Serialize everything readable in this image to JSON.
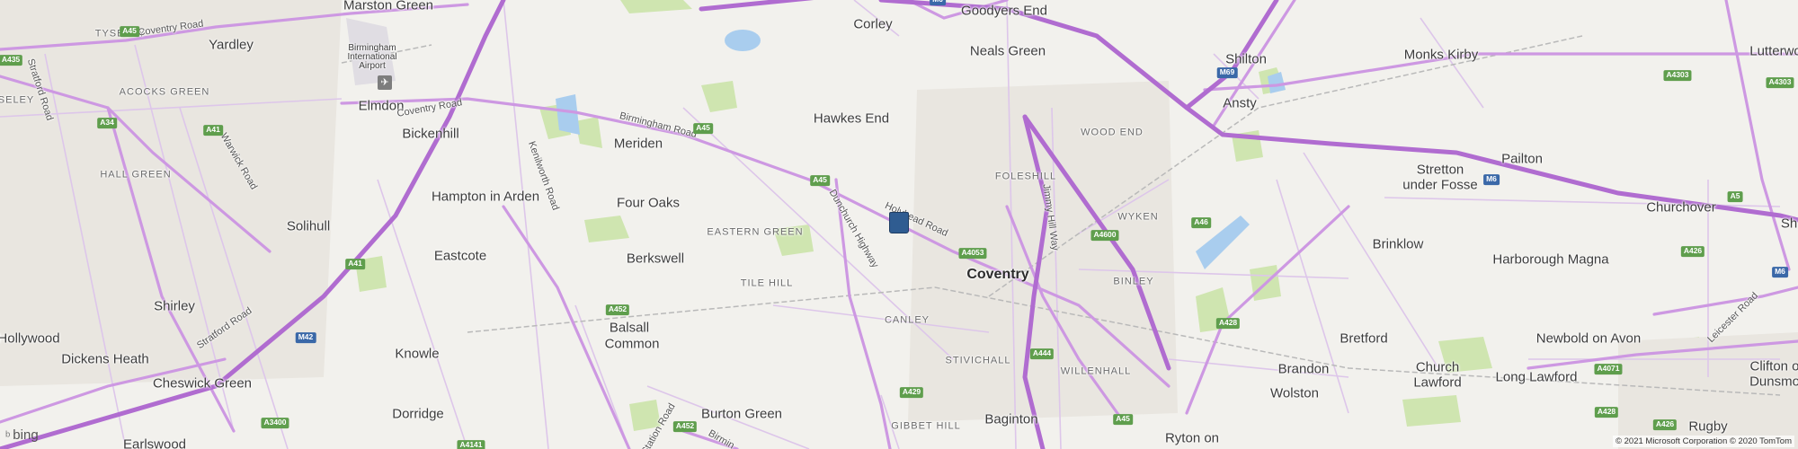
{
  "brand": {
    "logo_text": "bing",
    "icon": "bing-logo-icon"
  },
  "attribution": "© 2021 Microsoft Corporation © 2020 TomTom",
  "colors": {
    "background": "#f2f1ed",
    "motorway": "#b36ad1",
    "road": "#d3a7e8",
    "park": "#c9e2a9",
    "water": "#9cc7ec",
    "marker": "#2f5c91"
  },
  "marker": {
    "icon": "map-pin-icon"
  },
  "towns": [
    {
      "name": "Marston Green",
      "kind": "town"
    },
    {
      "name": "Yardley",
      "kind": "town"
    },
    {
      "name": "Birmingham International Airport",
      "kind": "airport"
    },
    {
      "name": "Elmdon",
      "kind": "town"
    },
    {
      "name": "Bickenhill",
      "kind": "town"
    },
    {
      "name": "Solihull",
      "kind": "town"
    },
    {
      "name": "Shirley",
      "kind": "town"
    },
    {
      "name": "Hollywood",
      "kind": "town"
    },
    {
      "name": "Dickens Heath",
      "kind": "town"
    },
    {
      "name": "Cheswick Green",
      "kind": "town"
    },
    {
      "name": "Earlswood",
      "kind": "town"
    },
    {
      "name": "Hampton in Arden",
      "kind": "town"
    },
    {
      "name": "Eastcote",
      "kind": "town"
    },
    {
      "name": "Knowle",
      "kind": "town"
    },
    {
      "name": "Dorridge",
      "kind": "town"
    },
    {
      "name": "Meriden",
      "kind": "town"
    },
    {
      "name": "Four Oaks",
      "kind": "town"
    },
    {
      "name": "Berkswell",
      "kind": "town"
    },
    {
      "name": "Balsall",
      "kind": "town"
    },
    {
      "name": "Common",
      "kind": "town"
    },
    {
      "name": "Burton Green",
      "kind": "town"
    },
    {
      "name": "Corley",
      "kind": "town"
    },
    {
      "name": "Goodyers End",
      "kind": "town"
    },
    {
      "name": "Neals Green",
      "kind": "town"
    },
    {
      "name": "Hawkes End",
      "kind": "town"
    },
    {
      "name": "Coventry",
      "kind": "city"
    },
    {
      "name": "Baginton",
      "kind": "town"
    },
    {
      "name": "Shilton",
      "kind": "town"
    },
    {
      "name": "Ansty",
      "kind": "town"
    },
    {
      "name": "Monks Kirby",
      "kind": "town"
    },
    {
      "name": "Lutterwo",
      "kind": "town"
    },
    {
      "name": "Pailton",
      "kind": "town"
    },
    {
      "name": "Stretton",
      "kind": "town"
    },
    {
      "name": "under Fosse",
      "kind": "town"
    },
    {
      "name": "Churchover",
      "kind": "town"
    },
    {
      "name": "Brinklow",
      "kind": "town"
    },
    {
      "name": "Harborough Magna",
      "kind": "town"
    },
    {
      "name": "Bretford",
      "kind": "town"
    },
    {
      "name": "Brandon",
      "kind": "town"
    },
    {
      "name": "Wolston",
      "kind": "town"
    },
    {
      "name": "Church",
      "kind": "town"
    },
    {
      "name": "Lawford",
      "kind": "town"
    },
    {
      "name": "Long Lawford",
      "kind": "town"
    },
    {
      "name": "Newbold on Avon",
      "kind": "town"
    },
    {
      "name": "Clifton o",
      "kind": "town"
    },
    {
      "name": "Dunsmo",
      "kind": "town"
    },
    {
      "name": "Rugby",
      "kind": "town"
    },
    {
      "name": "Ryton on",
      "kind": "town"
    },
    {
      "name": "Sh",
      "kind": "town"
    }
  ],
  "districts": [
    "TYSELEY",
    "SELEY",
    "ACOCKS GREEN",
    "HALL GREEN",
    "EASTERN GREEN",
    "TILE HILL",
    "CANLEY",
    "STIVICHALL",
    "GIBBET HILL",
    "WILLENHALL",
    "FOLESHILL",
    "WOOD END",
    "WYKEN",
    "BINLEY"
  ],
  "road_labels": [
    "Coventry Road",
    "Coventry Road",
    "Birmingham Road",
    "Stratford Road",
    "Warwick Road",
    "Kenilworth Road",
    "Stratford Road",
    "Dunchurch Highway",
    "Holyhead Road",
    "Jimmy Hill Way",
    "Leicester Road",
    "Station Road",
    "Birmin"
  ],
  "shields": [
    {
      "text": "A45",
      "type": "green"
    },
    {
      "text": "A435",
      "type": "green"
    },
    {
      "text": "A34",
      "type": "green"
    },
    {
      "text": "A41",
      "type": "green"
    },
    {
      "text": "A41",
      "type": "green"
    },
    {
      "text": "M42",
      "type": "blue"
    },
    {
      "text": "A3400",
      "type": "green"
    },
    {
      "text": "A4141",
      "type": "green"
    },
    {
      "text": "A452",
      "type": "green"
    },
    {
      "text": "A452",
      "type": "green"
    },
    {
      "text": "A45",
      "type": "green"
    },
    {
      "text": "A45",
      "type": "green"
    },
    {
      "text": "M6",
      "type": "blue"
    },
    {
      "text": "A4053",
      "type": "green"
    },
    {
      "text": "A4600",
      "type": "green"
    },
    {
      "text": "A444",
      "type": "green"
    },
    {
      "text": "A429",
      "type": "green"
    },
    {
      "text": "A45",
      "type": "green"
    },
    {
      "text": "A46",
      "type": "green"
    },
    {
      "text": "A428",
      "type": "green"
    },
    {
      "text": "M69",
      "type": "blue"
    },
    {
      "text": "M6",
      "type": "blue"
    },
    {
      "text": "A4303",
      "type": "green"
    },
    {
      "text": "A4303",
      "type": "green"
    },
    {
      "text": "A5",
      "type": "green"
    },
    {
      "text": "A426",
      "type": "green"
    },
    {
      "text": "M6",
      "type": "blue"
    },
    {
      "text": "A4071",
      "type": "green"
    },
    {
      "text": "A428",
      "type": "green"
    },
    {
      "text": "A426",
      "type": "green"
    }
  ]
}
